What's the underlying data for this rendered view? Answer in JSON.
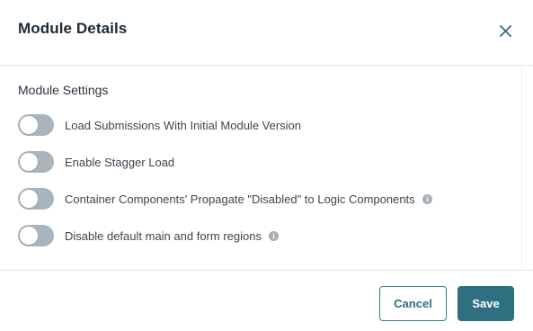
{
  "dialog": {
    "title": "Module Details",
    "close_icon": "close-icon"
  },
  "settings": {
    "section_title": "Module Settings",
    "items": [
      {
        "label": "Load Submissions With Initial Module Version",
        "enabled": false,
        "has_info": false
      },
      {
        "label": "Enable Stagger Load",
        "enabled": false,
        "has_info": false
      },
      {
        "label": "Container Components' Propagate \"Disabled\" to Logic Components",
        "enabled": false,
        "has_info": true
      },
      {
        "label": "Disable default main and form regions",
        "enabled": false,
        "has_info": true
      }
    ]
  },
  "footer": {
    "cancel_label": "Cancel",
    "save_label": "Save"
  },
  "colors": {
    "primary": "#2f6f82",
    "toggle_off": "#a9b4bd",
    "info_icon": "#a5afb8"
  }
}
